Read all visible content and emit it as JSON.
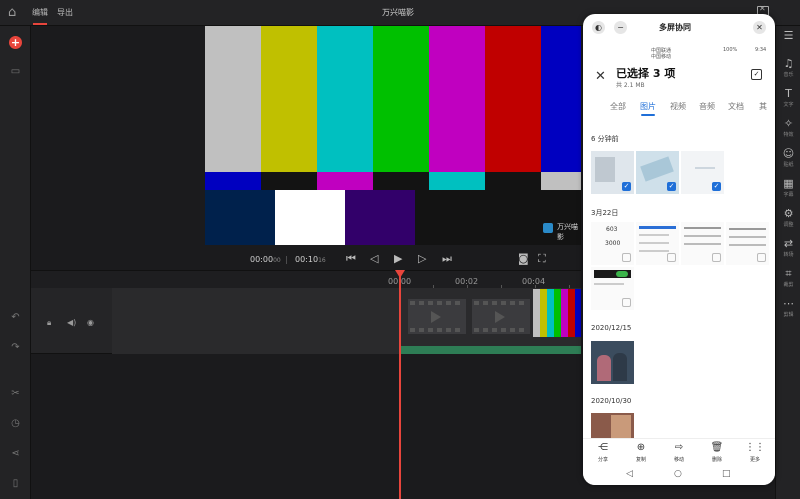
{
  "app": {
    "title": "万兴喵影",
    "menu": {
      "edit": "编辑",
      "export": "导出"
    }
  },
  "colors": {
    "accent": "#e8453c",
    "bg": "#1b1b1d",
    "panel": "#232325",
    "phone_accent": "#1f6fd8",
    "audio_track": "#2e7d55"
  },
  "preview": {
    "watermark": "万兴喵影",
    "current_time": "00:00",
    "current_frames": "00",
    "total_time": "00:10",
    "total_frames": "16"
  },
  "ruler": {
    "labels": [
      "00:00",
      "00:02",
      "00:04"
    ]
  },
  "right_tools": [
    {
      "icon": "list-icon",
      "glyph": "☰",
      "label": ""
    },
    {
      "icon": "music-icon",
      "glyph": "♫",
      "label": "音乐"
    },
    {
      "icon": "text-icon",
      "glyph": "T",
      "label": "文字"
    },
    {
      "icon": "effects-icon",
      "glyph": "✧",
      "label": "特效"
    },
    {
      "icon": "sticker-icon",
      "glyph": "☺",
      "label": "贴纸"
    },
    {
      "icon": "filter-icon",
      "glyph": "▦",
      "label": "字幕"
    },
    {
      "icon": "speed-icon",
      "glyph": "⚙",
      "label": "调整"
    },
    {
      "icon": "transition-icon",
      "glyph": "⇄",
      "label": "转场"
    },
    {
      "icon": "crop-icon",
      "glyph": "⌗",
      "label": "裁剪"
    },
    {
      "icon": "more-icon",
      "glyph": "⋯",
      "label": "剪辑"
    }
  ],
  "phone": {
    "header_title": "多屏协同",
    "status_carrier1": "中国联通",
    "status_carrier2": "中国移动",
    "status_battery": "100%",
    "status_time": "9:34",
    "selection_title": "已选择 3 项",
    "selection_size": "共 2.1 MB",
    "tabs": [
      "全部",
      "图片",
      "视频",
      "音频",
      "文档",
      "其"
    ],
    "sections": {
      "s1": "6 分钟前",
      "s2": "3月22日",
      "s3": "2020/12/15",
      "s4": "2020/10/30"
    },
    "thumb_text": {
      "n1": "603",
      "n2": "3000"
    },
    "actions": [
      {
        "icon": "share-icon",
        "glyph": "⋲",
        "label": "分享"
      },
      {
        "icon": "copy-icon",
        "glyph": "⊕",
        "label": "复制"
      },
      {
        "icon": "move-icon",
        "glyph": "⇨",
        "label": "移动"
      },
      {
        "icon": "delete-icon",
        "glyph": "🗑",
        "label": "删除"
      },
      {
        "icon": "more-icon",
        "glyph": "⋮⋮",
        "label": "更多"
      }
    ]
  }
}
